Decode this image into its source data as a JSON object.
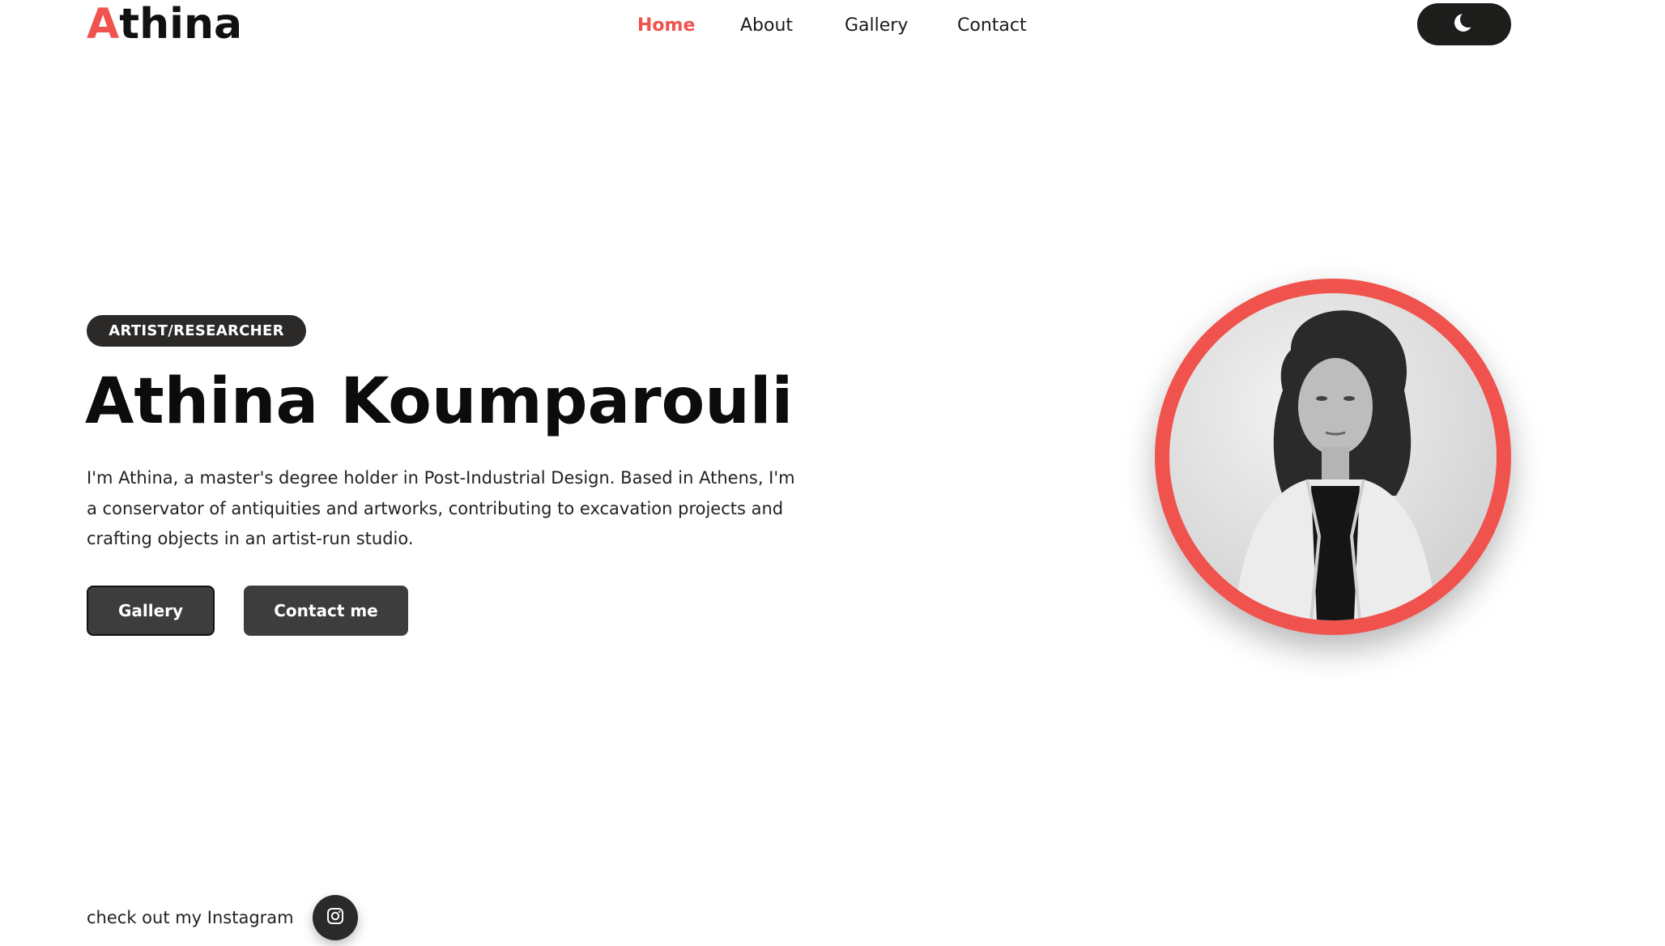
{
  "header": {
    "logo_initial": "A",
    "logo_rest": "thina",
    "nav": [
      {
        "label": "Home",
        "active": true
      },
      {
        "label": "About",
        "active": false
      },
      {
        "label": "Gallery",
        "active": false
      },
      {
        "label": "Contact",
        "active": false
      }
    ],
    "theme_toggle_icon": "moon-icon"
  },
  "hero": {
    "badge": "ARTIST/RESEARCHER",
    "name": "Athina Koumparouli",
    "bio": "I'm Athina, a master's degree holder in Post-Industrial Design. Based in Athens, I'm a conservator of antiquities and artworks, contributing to excavation projects and crafting objects in an artist-run studio.",
    "buttons": {
      "gallery": "Gallery",
      "contact": "Contact me"
    },
    "portrait_icon": "portrait-photo"
  },
  "footer": {
    "instagram_text": "check out my Instagram",
    "instagram_icon": "instagram-icon"
  },
  "colors": {
    "accent": "#f0524d",
    "dark": "#1d1d1b",
    "button": "#3d3d3d"
  }
}
